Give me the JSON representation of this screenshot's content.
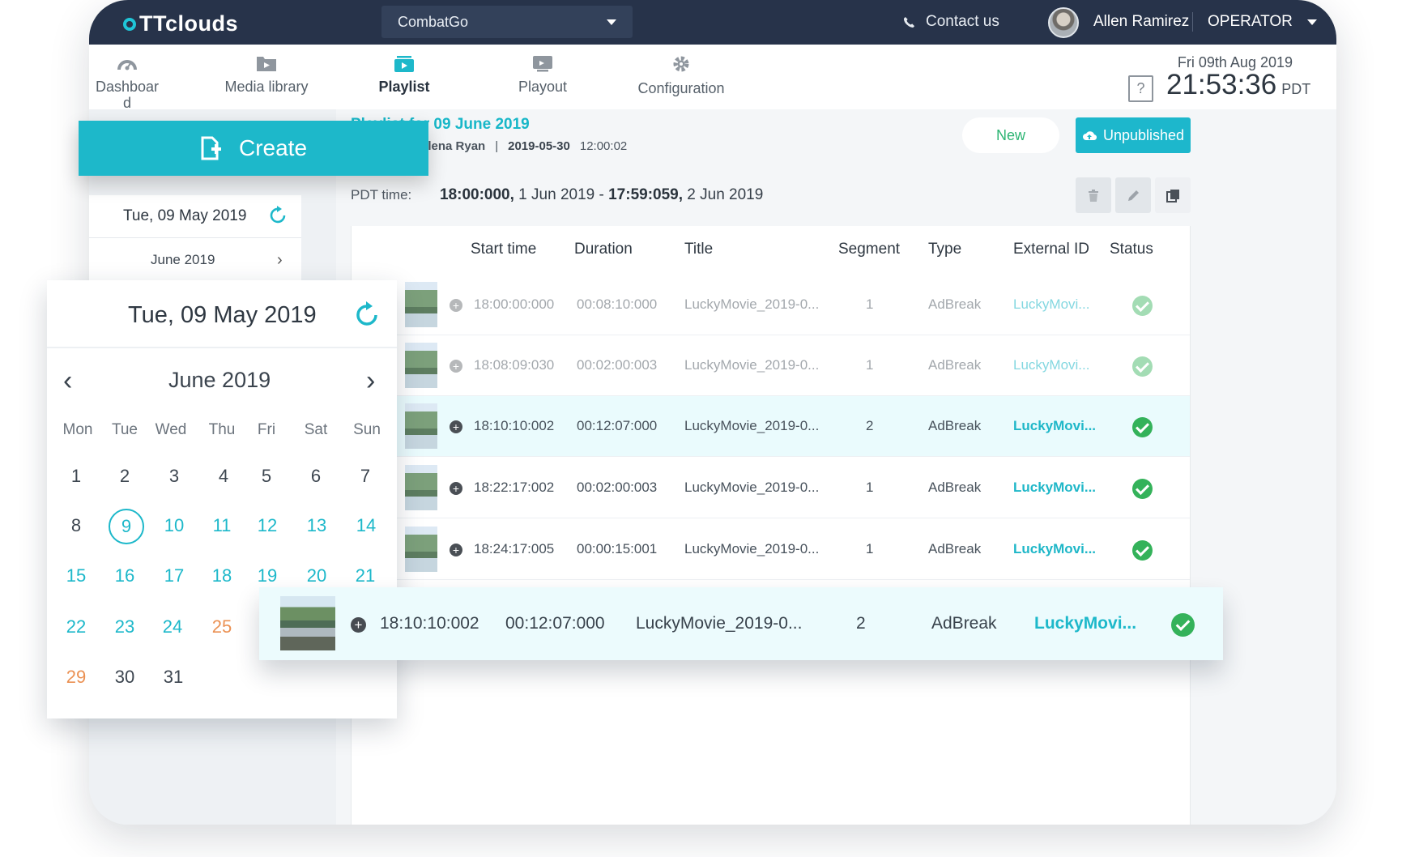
{
  "topbar": {
    "logo": "TTclouds",
    "app_select": "CombatGo",
    "contact": "Contact us",
    "user": "Allen Ramirez",
    "role": "OPERATOR"
  },
  "nav": {
    "items": [
      {
        "label": "Dashboar\nd"
      },
      {
        "label": "Media library"
      },
      {
        "label": "Playlist"
      },
      {
        "label": "Playout"
      },
      {
        "label": "Configuration"
      }
    ],
    "date": "Fri 09th Aug 2019",
    "time": "21:53:36",
    "tz": "PDT"
  },
  "left": {
    "date": "Tue, 09 May 2019",
    "month": "June 2019"
  },
  "create": {
    "label": "Create"
  },
  "playlist": {
    "title": "Playlist for 09 June 2019",
    "owner": "elena Ryan",
    "date": "2019-05-30",
    "time": "12:00:02",
    "new_label": "New",
    "unpublished_label": "Unpublished",
    "pdt_label": "PDT time:",
    "pdt_start_bold": "18:00:000,",
    "pdt_start": " 1 Jun 2019 - ",
    "pdt_end_bold": "17:59:059,",
    "pdt_end": " 2 Jun 2019"
  },
  "table": {
    "headers": {
      "start": "Start time",
      "duration": "Duration",
      "title": "Title",
      "segment": "Segment",
      "type": "Type",
      "external": "External ID",
      "status": "Status"
    },
    "rows": [
      {
        "start": "18:00:00:000",
        "duration": "00:08:10:000",
        "title": "LuckyMovie_2019-0...",
        "segment": "1",
        "type": "AdBreak",
        "external": "LuckyMovi..."
      },
      {
        "start": "18:08:09:030",
        "duration": "00:02:00:003",
        "title": "LuckyMovie_2019-0...",
        "segment": "1",
        "type": "AdBreak",
        "external": "LuckyMovi..."
      },
      {
        "start": "18:10:10:002",
        "duration": "00:12:07:000",
        "title": "LuckyMovie_2019-0...",
        "segment": "2",
        "type": "AdBreak",
        "external": "LuckyMovi..."
      },
      {
        "start": "18:22:17:002",
        "duration": "00:02:00:003",
        "title": "LuckyMovie_2019-0...",
        "segment": "1",
        "type": "AdBreak",
        "external": "LuckyMovi..."
      },
      {
        "start": "18:24:17:005",
        "duration": "00:00:15:001",
        "title": "LuckyMovie_2019-0...",
        "segment": "1",
        "type": "AdBreak",
        "external": "LuckyMovi..."
      }
    ]
  },
  "drag": {
    "start": "18:10:10:002",
    "duration": "00:12:07:000",
    "title": "LuckyMovie_2019-0...",
    "segment": "2",
    "type": "AdBreak",
    "external": "LuckyMovi..."
  },
  "calendar": {
    "date": "Tue, 09 May 2019",
    "month": "June 2019",
    "weekdays": [
      "Mon",
      "Tue",
      "Wed",
      "Thu",
      "Fri",
      "Sat",
      "Sun"
    ],
    "days": [
      "1",
      "2",
      "3",
      "4",
      "5",
      "6",
      "7",
      "8",
      "9",
      "10",
      "11",
      "12",
      "13",
      "14",
      "15",
      "16",
      "17",
      "18",
      "19",
      "20",
      "21",
      "22",
      "23",
      "24",
      "25",
      "29",
      "30",
      "31"
    ]
  }
}
